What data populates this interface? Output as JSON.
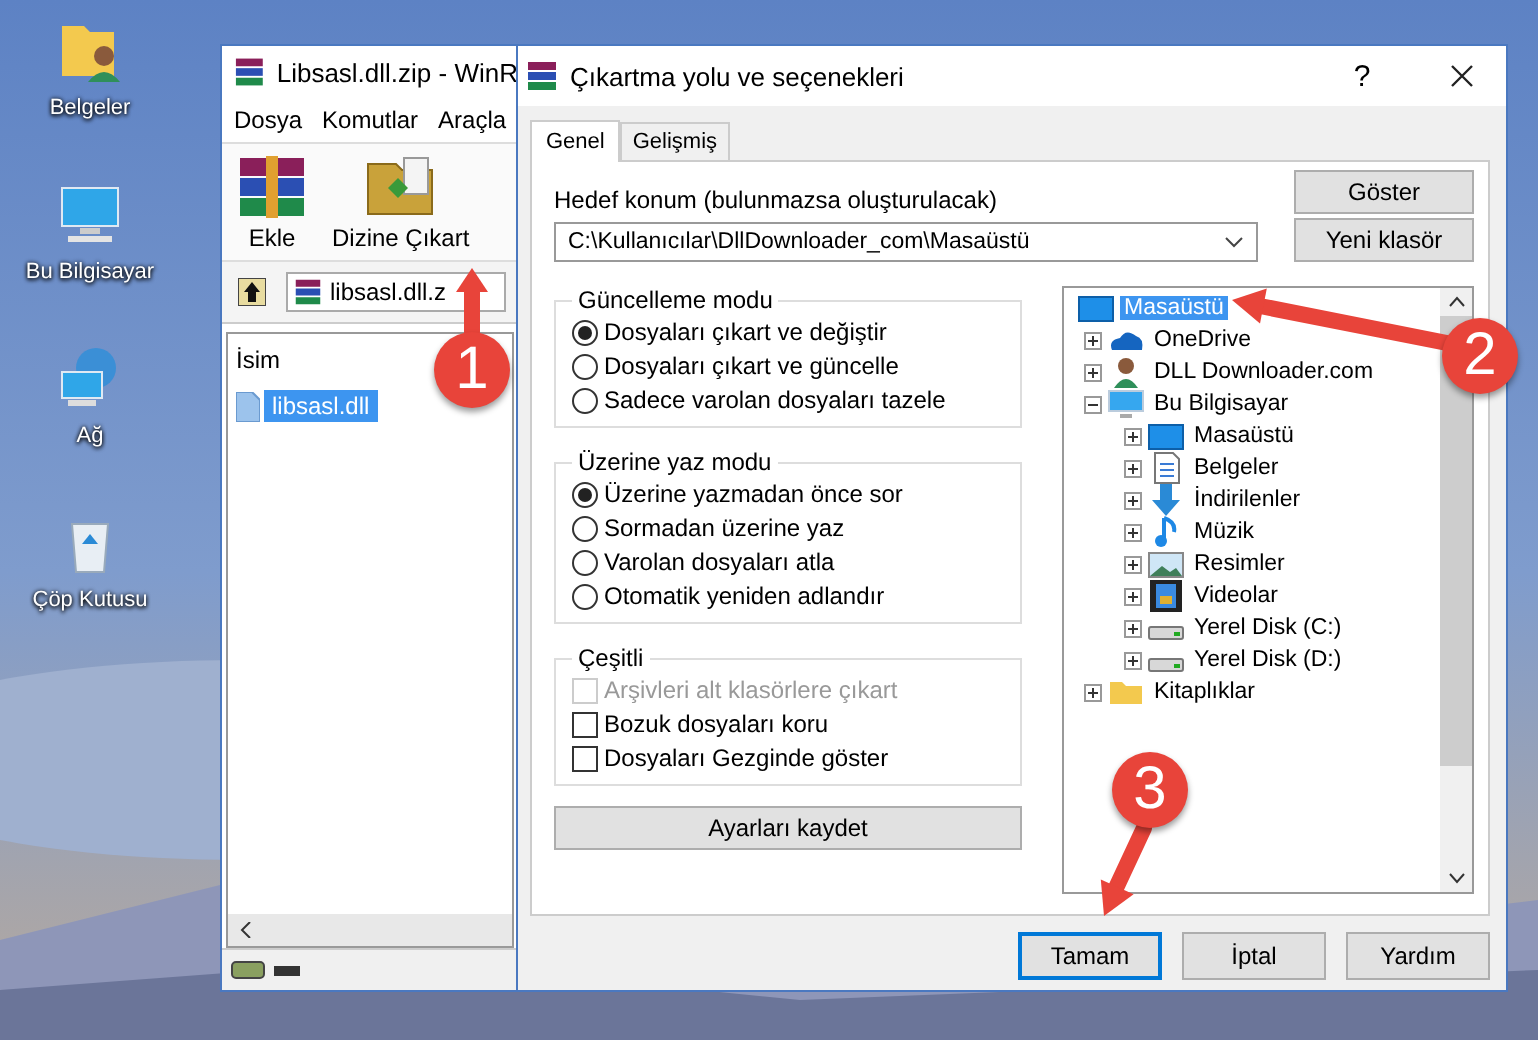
{
  "desktop_icons": [
    {
      "label": "Belgeler",
      "kind": "user-folder"
    },
    {
      "label": "Bu Bilgisayar",
      "kind": "computer"
    },
    {
      "label": "Ağ",
      "kind": "network"
    },
    {
      "label": "Çöp Kutusu",
      "kind": "recycle"
    }
  ],
  "archive_window": {
    "title": "Libsasl.dll.zip - WinR",
    "menu": [
      "Dosya",
      "Komutlar",
      "Araçla"
    ],
    "toolbar": [
      {
        "label": "Ekle",
        "kind": "add"
      },
      {
        "label": "Dizine Çıkart",
        "kind": "extract"
      }
    ],
    "path": "libsasl.dll.z",
    "column": "İsim",
    "files": [
      {
        "name": "libsasl.dll",
        "selected": true
      }
    ]
  },
  "dialog": {
    "title": "Çıkartma yolu ve seçenekleri",
    "help": "?",
    "tabs": [
      {
        "label": "Genel",
        "selected": true
      },
      {
        "label": "Gelişmiş",
        "selected": false
      }
    ],
    "destination_label": "Hedef konum (bulunmazsa oluşturulacak)",
    "destination": "C:\\Kullanıcılar\\DllDownloader_com\\Masaüstü",
    "side_buttons": [
      "Göster",
      "Yeni klasör"
    ],
    "groups": [
      {
        "title": "Güncelleme modu",
        "kind": "radio",
        "options": [
          {
            "label": "Dosyaları çıkart ve değiştir",
            "selected": true
          },
          {
            "label": "Dosyaları çıkart ve güncelle",
            "selected": false
          },
          {
            "label": "Sadece varolan dosyaları tazele",
            "selected": false
          }
        ]
      },
      {
        "title": "Üzerine yaz modu",
        "kind": "radio",
        "options": [
          {
            "label": "Üzerine yazmadan önce sor",
            "selected": true
          },
          {
            "label": "Sormadan üzerine yaz",
            "selected": false
          },
          {
            "label": "Varolan dosyaları atla",
            "selected": false
          },
          {
            "label": "Otomatik yeniden adlandır",
            "selected": false
          }
        ]
      },
      {
        "title": "Çeşitli",
        "kind": "checkbox",
        "options": [
          {
            "label": "Arşivleri alt klasörlere çıkart",
            "checked": false,
            "disabled": true
          },
          {
            "label": "Bozuk dosyaları koru",
            "checked": false,
            "disabled": false
          },
          {
            "label": "Dosyaları Gezginde göster",
            "checked": false,
            "disabled": false
          }
        ]
      }
    ],
    "save_button": "Ayarları kaydet",
    "tree": [
      {
        "label": "Masaüstü",
        "kind": "desktop",
        "selected": true,
        "children": [
          {
            "label": "OneDrive",
            "kind": "cloud",
            "selected": false,
            "expanded": false
          },
          {
            "label": "DLL Downloader.com",
            "kind": "user",
            "selected": false,
            "expanded": false
          },
          {
            "label": "Bu Bilgisayar",
            "kind": "computer",
            "selected": false,
            "expanded": true,
            "children": [
              {
                "label": "Masaüstü",
                "kind": "desktop",
                "selected": false,
                "expanded": false
              },
              {
                "label": "Belgeler",
                "kind": "documents",
                "selected": false,
                "expanded": false
              },
              {
                "label": "İndirilenler",
                "kind": "download",
                "selected": false,
                "expanded": false
              },
              {
                "label": "Müzik",
                "kind": "music",
                "selected": false,
                "expanded": false
              },
              {
                "label": "Resimler",
                "kind": "pictures",
                "selected": false,
                "expanded": false
              },
              {
                "label": "Videolar",
                "kind": "video",
                "selected": false,
                "expanded": false
              },
              {
                "label": "Yerel Disk (C:)",
                "kind": "disk",
                "selected": false,
                "expanded": false
              },
              {
                "label": "Yerel Disk (D:)",
                "kind": "disk",
                "selected": false,
                "expanded": false
              }
            ]
          },
          {
            "label": "Kitaplıklar",
            "kind": "folder",
            "selected": false,
            "expanded": false
          }
        ]
      }
    ],
    "buttons": [
      {
        "label": "Tamam",
        "selected": true
      },
      {
        "label": "İptal",
        "selected": false
      },
      {
        "label": "Yardım",
        "selected": false
      }
    ]
  },
  "annotations": [
    {
      "label": "1"
    },
    {
      "label": "2"
    },
    {
      "label": "3"
    }
  ]
}
